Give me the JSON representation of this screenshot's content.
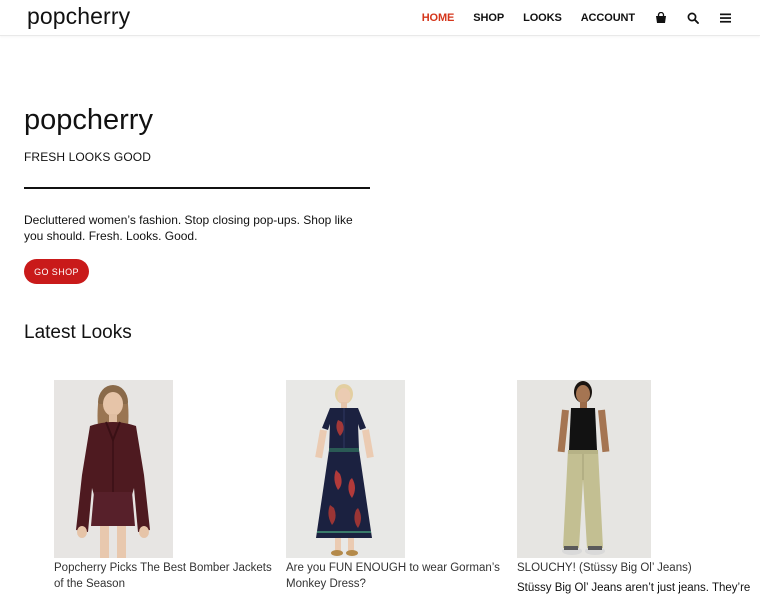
{
  "header": {
    "logo": "popcherry",
    "nav": [
      {
        "label": "HOME",
        "active": true
      },
      {
        "label": "SHOP",
        "active": false
      },
      {
        "label": "LOOKS",
        "active": false
      },
      {
        "label": "ACCOUNT",
        "active": false
      }
    ],
    "icons": [
      "shopping-bag-icon",
      "search-icon",
      "menu-icon"
    ]
  },
  "hero": {
    "title": "popcherry",
    "tagline": "FRESH LOOKS GOOD",
    "description": "Decluttered women’s fashion. Stop closing pop-ups. Shop like you should. Fresh. Looks. Good.",
    "cta": "GO SHOP"
  },
  "latest": {
    "title": "Latest Looks",
    "items": [
      {
        "title": "Popcherry Picks The Best Bomber Jackets of the Season"
      },
      {
        "title": "Are you FUN ENOUGH to wear Gorman’s Monkey Dress?"
      },
      {
        "title": "SLOUCHY! (Stüssy Big Ol’ Jeans)",
        "excerpt": "Stüssy Big Ol’ Jeans aren’t just jeans. They’re"
      }
    ]
  },
  "colors": {
    "accent": "#d5361b",
    "button": "#c91a1a",
    "text": "#111111"
  }
}
